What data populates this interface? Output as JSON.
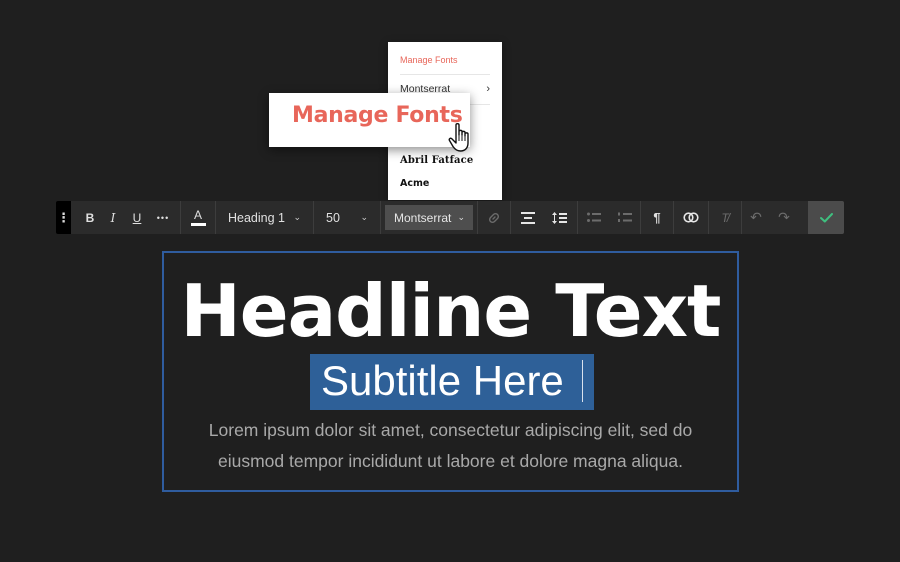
{
  "font_dropdown": {
    "manage_label": "Manage Fonts",
    "items": [
      {
        "label": "Montserrat",
        "has_submenu": true
      },
      {
        "label": "Abril Fatface"
      },
      {
        "label": "Acme"
      }
    ]
  },
  "callout": {
    "label": "Manage Fonts"
  },
  "toolbar": {
    "bold_label": "B",
    "italic_label": "I",
    "underline_label": "U",
    "more_label": "•••",
    "text_color_label": "A",
    "block_style": "Heading 1",
    "font_size": "50",
    "font_family": "Montserrat",
    "dropdown_chevron": "⌄",
    "colors": {
      "background": "#2b2b2b",
      "confirm_check": "#3fbf7f",
      "active_font_select": "#4e4e4e"
    }
  },
  "content": {
    "headline": "Headline Text",
    "subtitle": "Subtitle Here",
    "body_line_1": "Lorem ipsum dolor sit amet, consectetur adipiscing elit, sed do",
    "body_line_2": "eiusmod tempor incididunt ut labore et dolore magna aliqua.",
    "colors": {
      "selection": "#2e6098",
      "block_border": "#2f5c9e",
      "accent": "#e8665a"
    }
  }
}
